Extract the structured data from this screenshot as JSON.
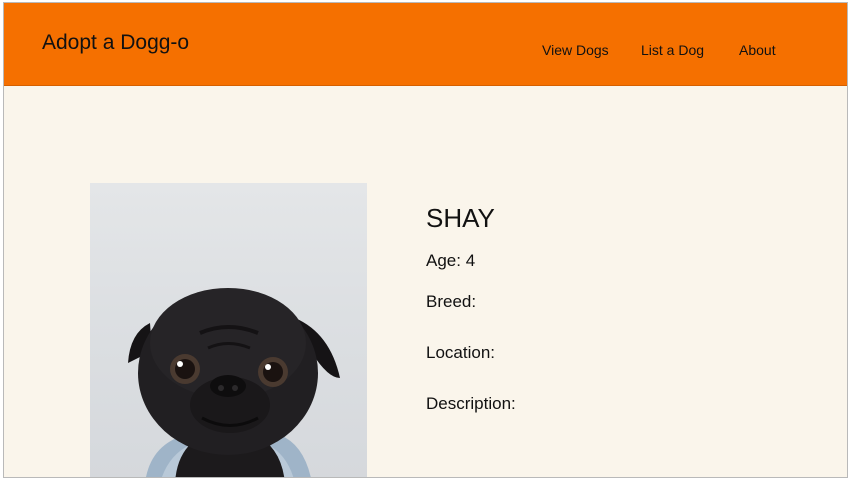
{
  "header": {
    "brand": "Adopt a Dogg-o",
    "nav": {
      "view_dogs": "View Dogs",
      "list_dog": "List a Dog",
      "about": "About"
    }
  },
  "dog": {
    "name": "SHAY",
    "age_label": "Age:",
    "age_value": "4",
    "breed_label": "Breed:",
    "breed_value": "",
    "location_label": "Location:",
    "location_value": "",
    "description_label": "Description:",
    "description_value": ""
  },
  "colors": {
    "header_bg": "#f57000",
    "page_bg": "#faf5eb",
    "text": "#111111"
  },
  "icons": {
    "photo": "pug-photo"
  }
}
